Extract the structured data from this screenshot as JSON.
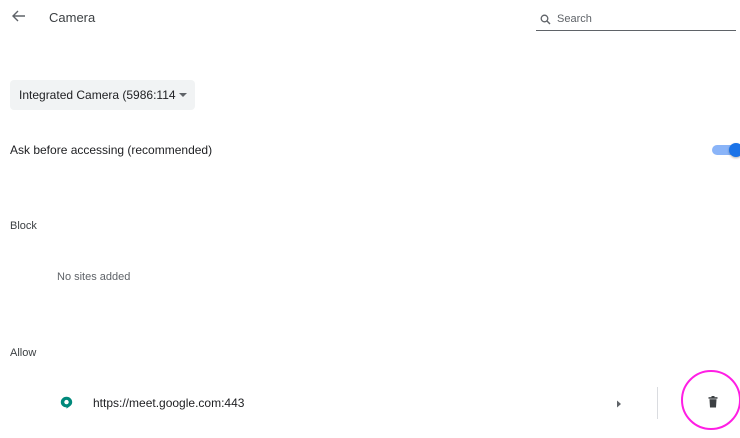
{
  "header": {
    "back_icon": "arrow-left-icon",
    "title": "Camera",
    "search": {
      "icon": "search-icon",
      "placeholder": "Search",
      "value": ""
    }
  },
  "device_selector": {
    "selected": "Integrated Camera (5986:114⁠",
    "icon": "caret-down-icon"
  },
  "ask_setting": {
    "label": "Ask before accessing (recommended)",
    "enabled": true
  },
  "block_section": {
    "label": "Block",
    "empty_text": "No sites added"
  },
  "allow_section": {
    "label": "Allow",
    "sites": [
      {
        "url": "https://meet.google.com:443",
        "icon": "google-meet-icon",
        "arrow_icon": "arrow-right-icon",
        "delete_icon": "trash-icon"
      }
    ]
  },
  "colors": {
    "accent": "#1a73e8",
    "toggle_track": "#8ab4f8",
    "highlight": "#ff1ee4",
    "meet_icon": "#00897b"
  }
}
